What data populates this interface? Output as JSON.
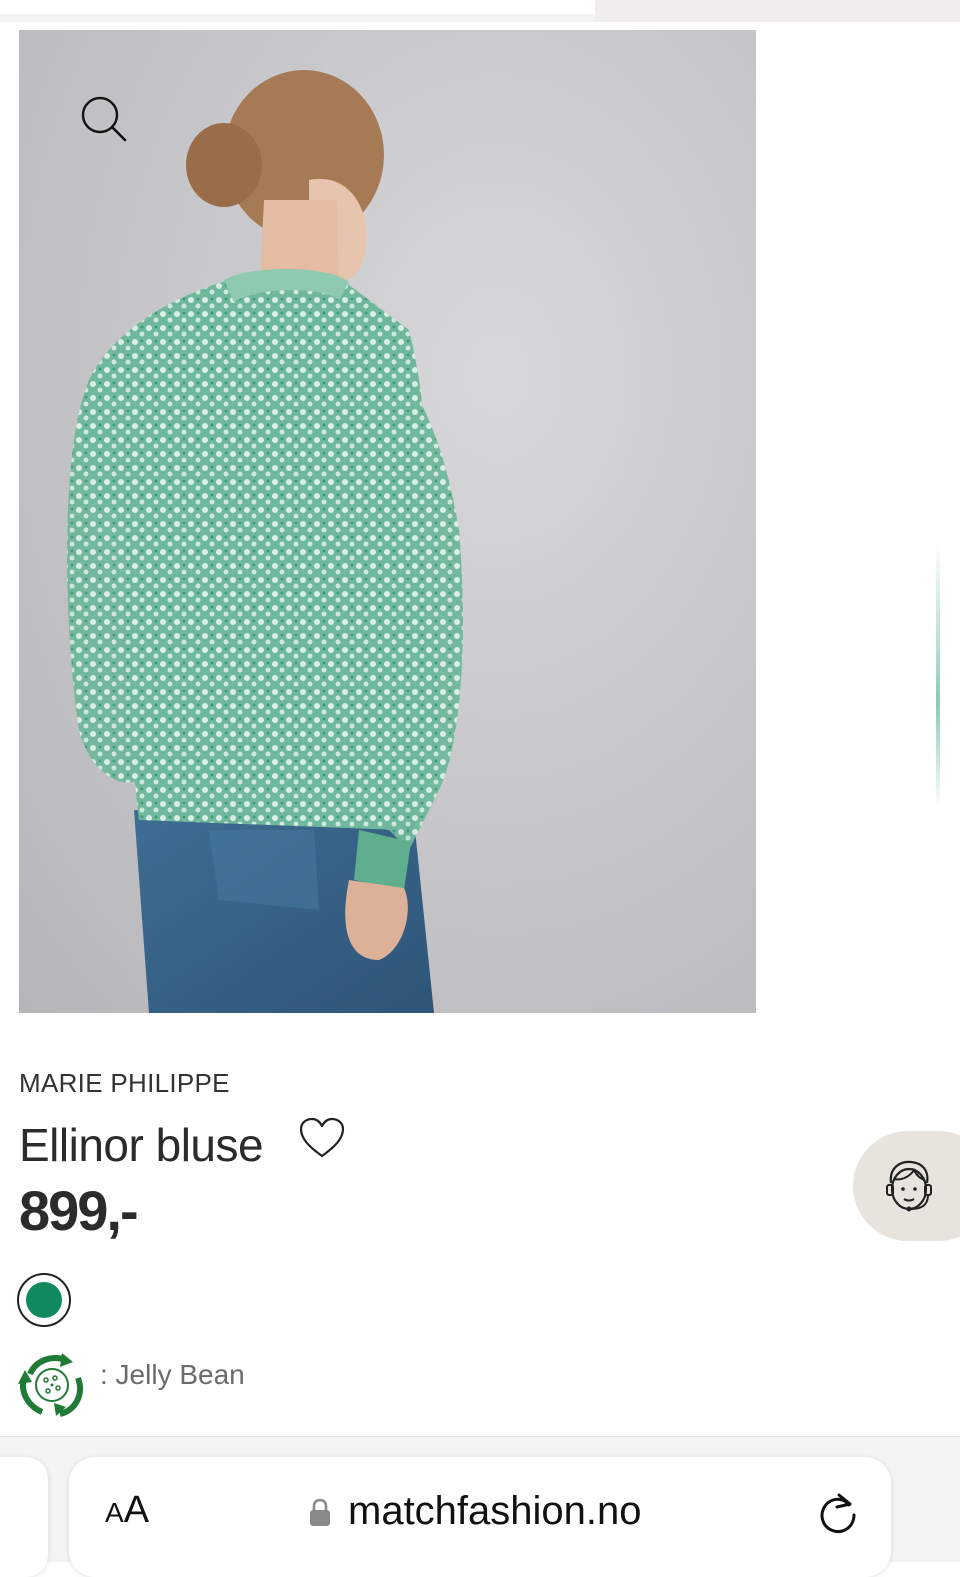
{
  "product": {
    "brand": "MARIE PHILIPPE",
    "name": "Ellinor bluse",
    "price": "899,-",
    "selected_color": "#0f8a5c",
    "material_label": ": Jelly Bean",
    "accent_green": "#1f7a35",
    "image_alt": "Back view of woman wearing green patterned blouse and jeans"
  },
  "icons": {
    "zoom": "magnifier-icon",
    "favorite": "heart-icon",
    "support": "customer-support-icon",
    "material": "recycle-icon",
    "lock": "lock-icon",
    "reload": "reload-icon"
  },
  "browser": {
    "text_size_button": "AA",
    "url": "matchfashion.no"
  }
}
